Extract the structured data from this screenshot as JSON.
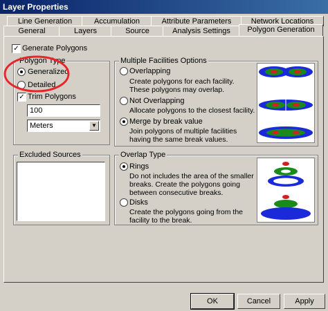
{
  "window": {
    "title": "Layer Properties"
  },
  "tabs_back": [
    "Line Generation",
    "Accumulation",
    "Attribute Parameters",
    "Network Locations"
  ],
  "tabs_front": [
    "General",
    "Layers",
    "Source",
    "Analysis Settings",
    "Polygon Generation"
  ],
  "generate_polygons": {
    "label": "Generate Polygons",
    "checked": true
  },
  "polygon_type": {
    "legend": "Polygon Type",
    "generalized": "Generalized",
    "detailed": "Detailed",
    "trim_label": "Trim Polygons",
    "trim_value": "100",
    "units": "Meters"
  },
  "multiple_facilities": {
    "legend": "Multiple Facilities Options",
    "overlapping": {
      "label": "Overlapping",
      "desc": "Create polygons for each facility. These polygons may overlap."
    },
    "not_overlapping": {
      "label": "Not Overlapping",
      "desc": "Allocate polygons to the closest facility."
    },
    "merge": {
      "label": "Merge by break value",
      "desc": "Join polygons of multiple facilities having the same break values."
    }
  },
  "excluded_sources": {
    "legend": "Excluded Sources"
  },
  "overlap_type": {
    "legend": "Overlap Type",
    "rings": {
      "label": "Rings",
      "desc": "Do not includes the area of the smaller breaks. Create the polygons going between consecutive breaks."
    },
    "disks": {
      "label": "Disks",
      "desc": "Create the polygons going from the facility to the break."
    }
  },
  "buttons": {
    "ok": "OK",
    "cancel": "Cancel",
    "apply": "Apply"
  },
  "colors": {
    "annotation": "#e8242a",
    "ring_red": "#d42020",
    "ring_green": "#1a8a1a",
    "ring_blue": "#1a2ad8"
  }
}
